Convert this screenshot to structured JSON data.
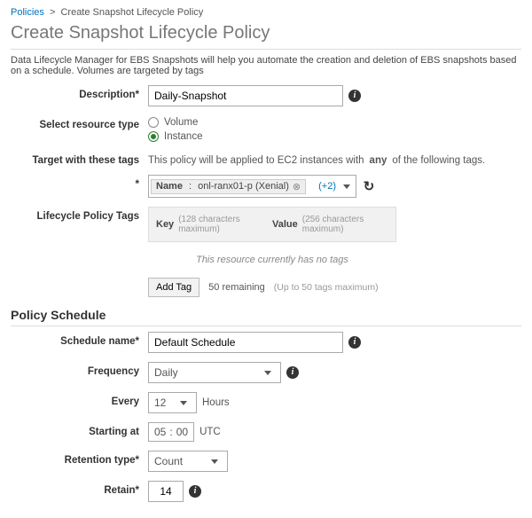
{
  "breadcrumb": {
    "root": "Policies",
    "current": "Create Snapshot Lifecycle Policy"
  },
  "title": "Create Snapshot Lifecycle Policy",
  "intro": "Data Lifecycle Manager for EBS Snapshots will help you automate the creation and deletion of EBS snapshots based on a schedule. Volumes are targeted by tags",
  "description": {
    "label": "Description*",
    "value": "Daily-Snapshot"
  },
  "resource_type": {
    "label": "Select resource type",
    "options": {
      "volume": "Volume",
      "instance": "Instance"
    },
    "selected": "instance"
  },
  "target_tags": {
    "label": "Target with these tags",
    "help": "This policy will be applied to EC2 instances with any of the following tags.",
    "asterisk": "*",
    "chip": {
      "key": "Name",
      "value": "onl-ranx01-p (Xenial)"
    },
    "more": "(+2)"
  },
  "policy_tags": {
    "label": "Lifecycle Policy Tags",
    "headers": {
      "key": "Key",
      "key_hint": "(128 characters maximum)",
      "value": "Value",
      "value_hint": "(256 characters maximum)"
    },
    "empty": "This resource currently has no tags",
    "add_tag": "Add Tag",
    "remaining": "50 remaining",
    "remaining_hint": "(Up to 50 tags maximum)"
  },
  "schedule": {
    "section_title": "Policy Schedule",
    "name_label": "Schedule name*",
    "name_value": "Default Schedule",
    "frequency_label": "Frequency",
    "frequency_value": "Daily",
    "every_label": "Every",
    "every_value": "12",
    "every_unit": "Hours",
    "starting_label": "Starting at",
    "start_hh": "05",
    "start_sep": ":",
    "start_mm": "00",
    "start_tz": "UTC",
    "retention_type_label": "Retention type*",
    "retention_type_value": "Count",
    "retain_label": "Retain*",
    "retain_value": "14"
  }
}
